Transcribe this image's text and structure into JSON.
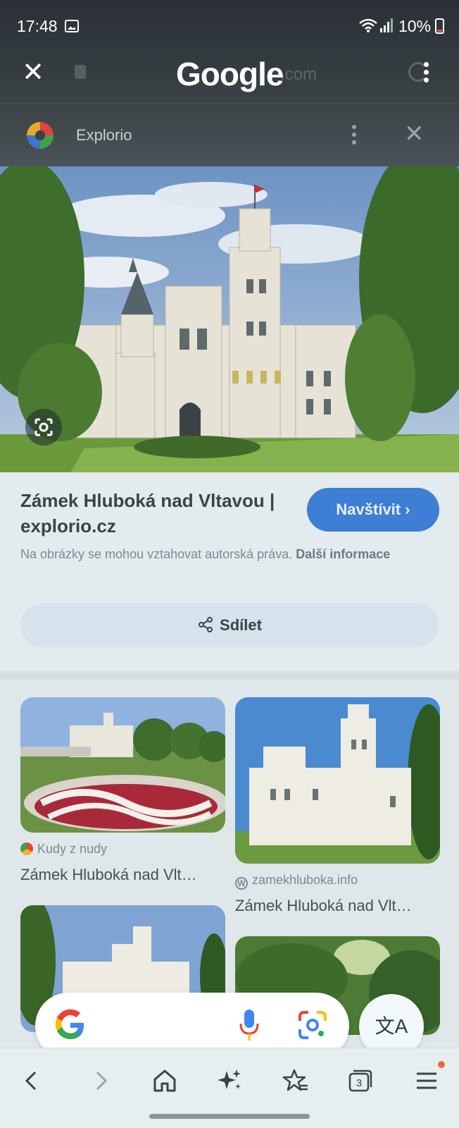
{
  "status_bar": {
    "time": "17:48",
    "battery": "10%"
  },
  "header": {
    "logo": "Google",
    "url_ghost": ".com"
  },
  "site": {
    "name": "Explorio"
  },
  "result": {
    "title": "Zámek Hluboká nad Vltavou | explorio.cz",
    "visit_label": "Navštívit",
    "copyright_text": "Na obrázky se mohou vztahovat autorská práva.",
    "more_info": "Další informace",
    "share_label": "Sdílet"
  },
  "related": [
    {
      "source": "Kudy z nudy",
      "title": "Zámek Hluboká nad Vlt…"
    },
    {
      "source": "zamekhluboka.info",
      "title": "Zámek Hluboká nad Vlt…"
    }
  ],
  "icons": {
    "close": "close-icon",
    "menu": "more-vert-icon",
    "lens": "google-lens-icon",
    "mic": "mic-icon",
    "translate": "translate-icon",
    "back": "back-icon",
    "forward": "forward-icon",
    "home": "home-icon",
    "ai": "sparkle-icon",
    "bookmarks": "bookmark-star-icon",
    "tabs": "tabs-icon",
    "overflow": "hamburger-icon"
  },
  "tabs_count": "3",
  "colors": {
    "accent": "#3e7ed4",
    "header_bg": "#3a4246",
    "panel_bg": "#e3ebee"
  }
}
